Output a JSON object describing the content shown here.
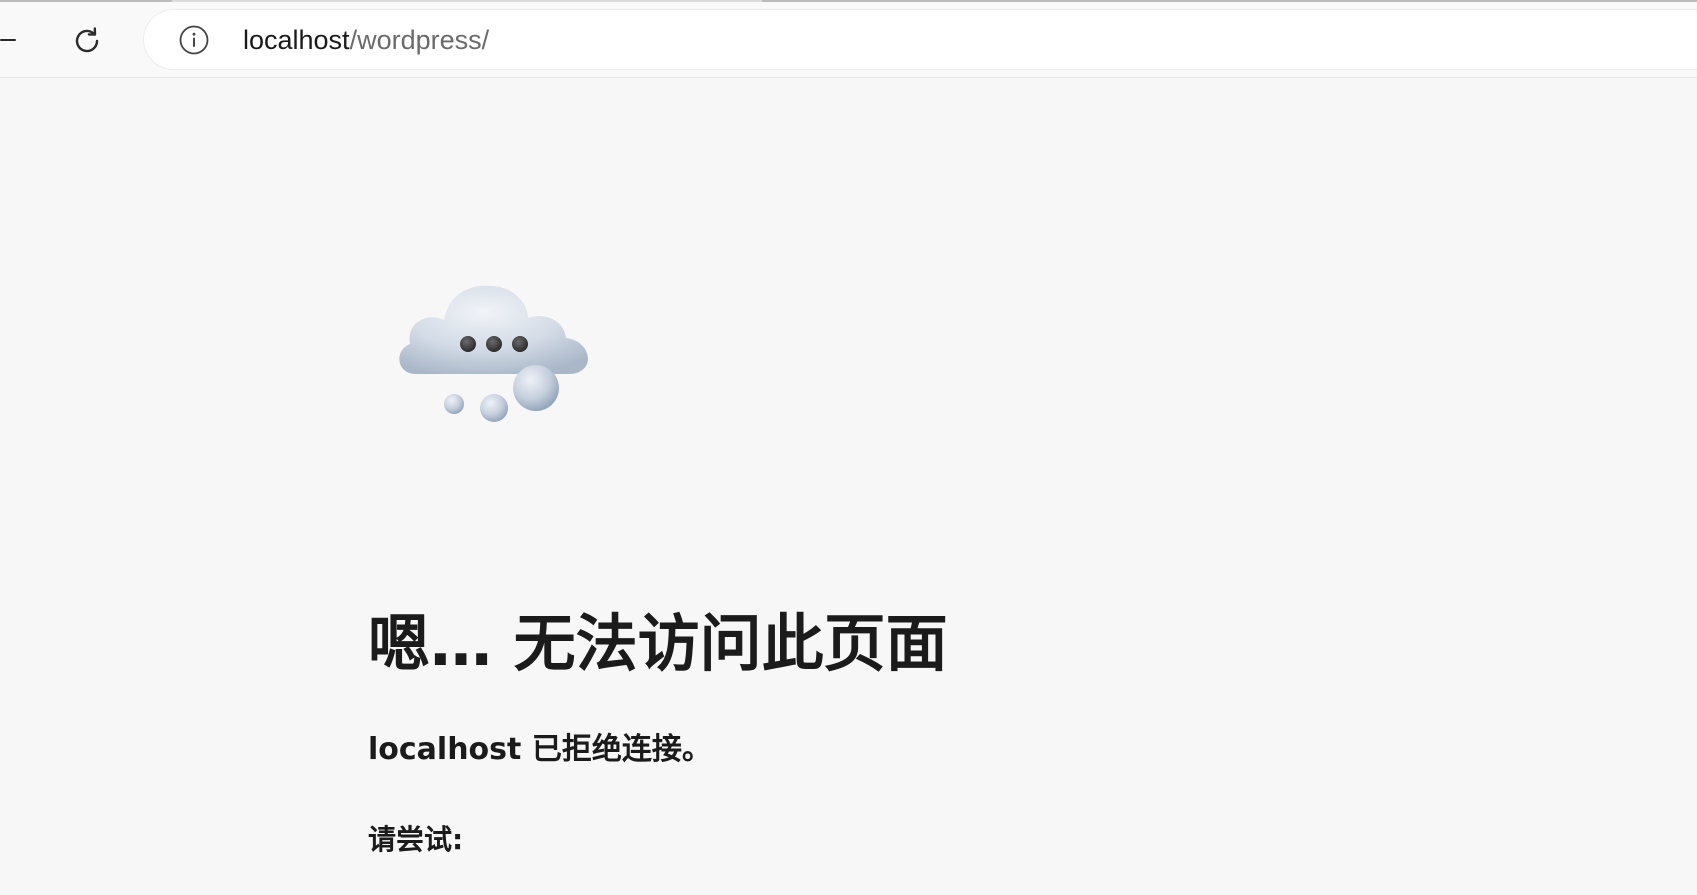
{
  "browser": {
    "address_bar": {
      "host": "localhost",
      "path": "/wordpress/"
    },
    "icons": {
      "back": "back-arrow-icon",
      "reload": "reload-icon",
      "site_info": "info-circle-icon"
    }
  },
  "error_page": {
    "illustration": "thinking-cloud-icon",
    "title": "嗯… 无法访问此页面",
    "subtitle": "localhost 已拒绝连接。",
    "try_label": "请尝试:"
  },
  "colors": {
    "page_background": "#f7f7f7",
    "text": "#1b1b1b",
    "url_path": "#6b6b6b"
  }
}
